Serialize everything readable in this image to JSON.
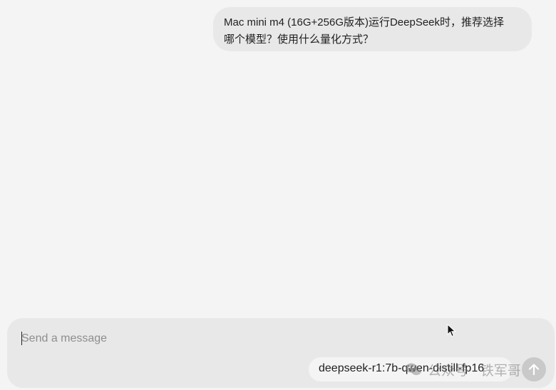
{
  "conversation": {
    "user_message": {
      "line1": "Mac mini m4 (16G+256G版本)运行DeepSeek时，推荐选择",
      "line2": "哪个模型？使用什么量化方式？"
    }
  },
  "composer": {
    "placeholder": "Send a message",
    "value": "",
    "model_selector_label": "deepseek-r1:7b-qwen-distill-fp16",
    "send_icon": "arrow-up-icon"
  },
  "watermark": {
    "text": "公众号 · 铁军哥",
    "icon": "wechat-icon"
  },
  "colors": {
    "background": "#f4f4f4",
    "bubble": "#e8e8e8",
    "send_button_disabled": "#c9c9c9"
  }
}
